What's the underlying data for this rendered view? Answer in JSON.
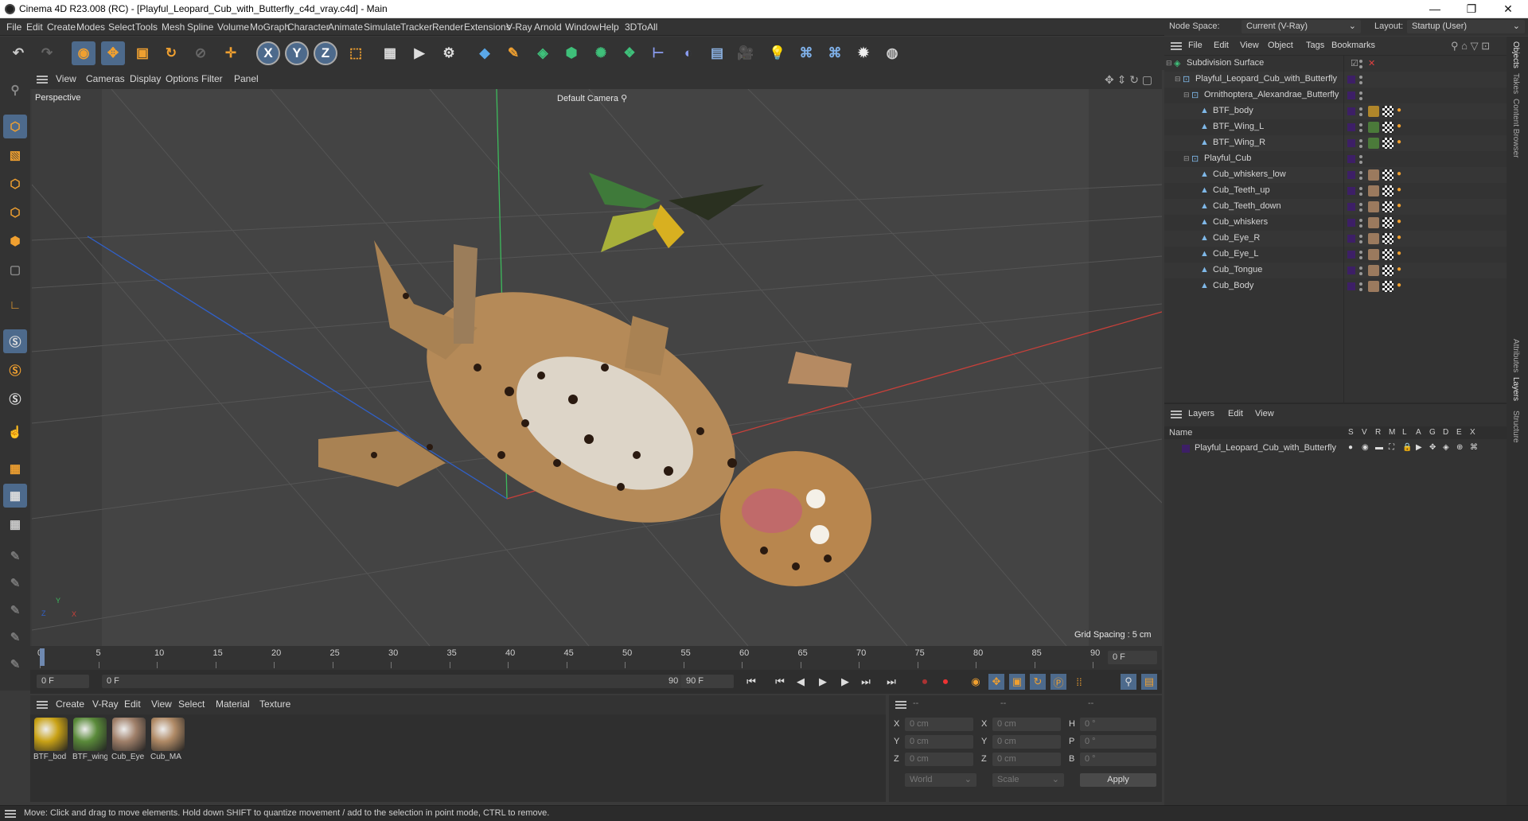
{
  "titlebar": {
    "title": "Cinema 4D R23.008 (RC) - [Playful_Leopard_Cub_with_Butterfly_c4d_vray.c4d] - Main",
    "minimize": "—",
    "maximize": "❐",
    "close": "✕"
  },
  "menubar": {
    "items": [
      "File",
      "Edit",
      "Create",
      "Modes",
      "Select",
      "Tools",
      "Mesh",
      "Spline",
      "Volume",
      "MoGraph",
      "Character",
      "Animate",
      "Simulate",
      "Tracker",
      "Render",
      "Extensions",
      "V-Ray",
      "Arnold",
      "Window",
      "Help",
      "3DToAll"
    ]
  },
  "nodespace": {
    "label": "Node Space:",
    "value": "Current (V-Ray)",
    "layout_label": "Layout:",
    "layout_value": "Startup (User)"
  },
  "viewport": {
    "menu": [
      "View",
      "Cameras",
      "Display",
      "Options",
      "Filter",
      "Panel"
    ],
    "label": "Perspective",
    "camera": "Default Camera",
    "grid_spacing": "Grid Spacing : 5 cm",
    "axis_x": "X",
    "axis_y": "Y",
    "axis_z": "Z"
  },
  "timeline": {
    "ticks": [
      "0",
      "5",
      "10",
      "15",
      "20",
      "25",
      "30",
      "35",
      "40",
      "45",
      "50",
      "55",
      "60",
      "65",
      "70",
      "75",
      "80",
      "85",
      "90"
    ],
    "frame_display": "0 F"
  },
  "transport": {
    "start": "0 F",
    "current": "0 F",
    "end_inner": "90 F",
    "end": "90 F"
  },
  "materials": {
    "menu": [
      "Create",
      "V-Ray",
      "Edit",
      "View",
      "Select",
      "Material",
      "Texture"
    ],
    "items": [
      {
        "name": "BTF_bod",
        "color": "#c9a216"
      },
      {
        "name": "BTF_wing",
        "color": "#5a8a3a"
      },
      {
        "name": "Cub_Eye",
        "color": "#a0806a"
      },
      {
        "name": "Cub_MA",
        "color": "#b08a66"
      }
    ]
  },
  "coords": {
    "header": [
      "--",
      "--",
      "--"
    ],
    "rows": [
      {
        "a": "X",
        "av": "0 cm",
        "b": "X",
        "bv": "0 cm",
        "c": "H",
        "cv": "0 °"
      },
      {
        "a": "Y",
        "av": "0 cm",
        "b": "Y",
        "bv": "0 cm",
        "c": "P",
        "cv": "0 °"
      },
      {
        "a": "Z",
        "av": "0 cm",
        "b": "Z",
        "bv": "0 cm",
        "c": "B",
        "cv": "0 °"
      }
    ],
    "world": "World",
    "scale": "Scale",
    "apply": "Apply"
  },
  "objects": {
    "menu": [
      "File",
      "Edit",
      "View",
      "Object",
      "Tags",
      "Bookmarks"
    ],
    "items": [
      {
        "name": "Subdivision Surface",
        "indent": 0,
        "kind": "subdiv"
      },
      {
        "name": "Playful_Leopard_Cub_with_Butterfly",
        "indent": 1,
        "kind": "null"
      },
      {
        "name": "Ornithoptera_Alexandrae_Butterfly",
        "indent": 2,
        "kind": "null"
      },
      {
        "name": "BTF_body",
        "indent": 3,
        "kind": "mesh",
        "tag": "body"
      },
      {
        "name": "BTF_Wing_L",
        "indent": 3,
        "kind": "mesh",
        "tag": "wing"
      },
      {
        "name": "BTF_Wing_R",
        "indent": 3,
        "kind": "mesh",
        "tag": "wing"
      },
      {
        "name": "Playful_Cub",
        "indent": 2,
        "kind": "null"
      },
      {
        "name": "Cub_whiskers_low",
        "indent": 3,
        "kind": "mesh",
        "tag": "cub"
      },
      {
        "name": "Cub_Teeth_up",
        "indent": 3,
        "kind": "mesh",
        "tag": "cub"
      },
      {
        "name": "Cub_Teeth_down",
        "indent": 3,
        "kind": "mesh",
        "tag": "cub"
      },
      {
        "name": "Cub_whiskers",
        "indent": 3,
        "kind": "mesh",
        "tag": "cub"
      },
      {
        "name": "Cub_Eye_R",
        "indent": 3,
        "kind": "mesh",
        "tag": "cub"
      },
      {
        "name": "Cub_Eye_L",
        "indent": 3,
        "kind": "mesh",
        "tag": "cub"
      },
      {
        "name": "Cub_Tongue",
        "indent": 3,
        "kind": "mesh",
        "tag": "cub"
      },
      {
        "name": "Cub_Body",
        "indent": 3,
        "kind": "mesh",
        "tag": "cub"
      }
    ]
  },
  "layers": {
    "menu": [
      "Layers",
      "Edit",
      "View"
    ],
    "col_name": "Name",
    "cols": [
      "S",
      "V",
      "R",
      "M",
      "L",
      "A",
      "G",
      "D",
      "E",
      "X"
    ],
    "items": [
      {
        "name": "Playful_Leopard_Cub_with_Butterfly",
        "color": "#3d1f66"
      }
    ]
  },
  "rightstrip": {
    "tabs": [
      "Objects",
      "Takes",
      "Content Browser",
      "Attributes",
      "Layers",
      "Structure"
    ]
  },
  "status": {
    "text": "Move: Click and drag to move elements. Hold down SHIFT to quantize movement / add to the selection in point mode, CTRL to remove."
  },
  "colors": {
    "accent": "#4d6a8c",
    "layer_swatch": "#3d1f66",
    "axis_x": "#c0392b",
    "axis_y": "#27ae60",
    "axis_z": "#2f5fbf"
  }
}
